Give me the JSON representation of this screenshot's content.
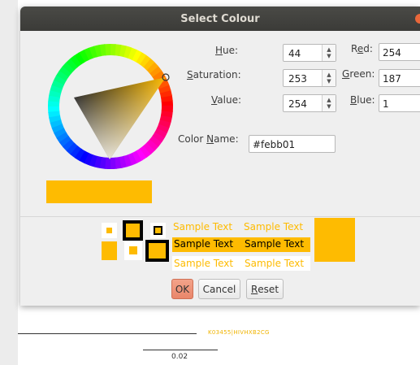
{
  "dialog": {
    "title": "Select Colour"
  },
  "fields": {
    "hue": {
      "label_pre": "",
      "mnemonic": "H",
      "label_post": "ue:",
      "value": "44"
    },
    "saturation": {
      "label_pre": "",
      "mnemonic": "S",
      "label_post": "aturation:",
      "value": "253"
    },
    "value": {
      "label_pre": "",
      "mnemonic": "V",
      "label_post": "alue:",
      "value": "254"
    },
    "red": {
      "label_pre": "R",
      "mnemonic": "e",
      "label_post": "d:",
      "value": "254"
    },
    "green": {
      "label_pre": "",
      "mnemonic": "G",
      "label_post": "reen:",
      "value": "187"
    },
    "blue": {
      "label_pre": "",
      "mnemonic": "B",
      "label_post": "lue:",
      "value": "1"
    },
    "color_name": {
      "label_pre": "Color ",
      "mnemonic": "N",
      "label_post": "ame:",
      "value": "#febb01"
    }
  },
  "samples": {
    "text": "Sample Text"
  },
  "buttons": {
    "ok": "OK",
    "cancel": "Cancel",
    "reset_mnemonic": "R",
    "reset_rest": "eset"
  },
  "background": {
    "leaf_label": "K03455|HIVHXB2CG",
    "scale_label": "0.02"
  },
  "colors": {
    "selected": "#febb01",
    "titlebar": "#3f3f3c",
    "ok_button": "#ec8f73",
    "close_button": "#e9673a"
  },
  "icons": [
    "spin-arrows-icon",
    "close-icon"
  ]
}
